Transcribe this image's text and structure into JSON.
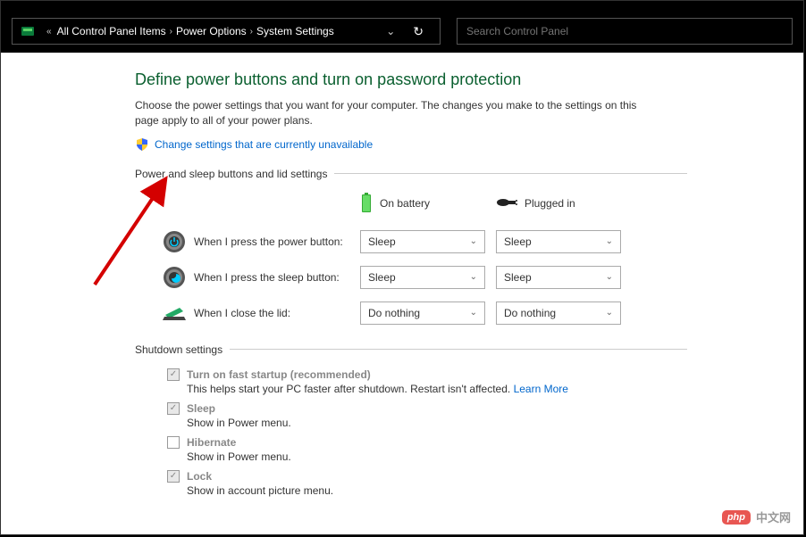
{
  "breadcrumb": {
    "prefix": "«",
    "items": [
      "All Control Panel Items",
      "Power Options",
      "System Settings"
    ]
  },
  "search": {
    "placeholder": "Search Control Panel"
  },
  "page": {
    "title": "Define power buttons and turn on password protection",
    "description": "Choose the power settings that you want for your computer. The changes you make to the settings on this page apply to all of your power plans.",
    "change_link": "Change settings that are currently unavailable"
  },
  "power_section": {
    "header": "Power and sleep buttons and lid settings",
    "col_battery": "On battery",
    "col_plugged": "Plugged in",
    "rows": [
      {
        "label": "When I press the power button:",
        "battery": "Sleep",
        "plugged": "Sleep"
      },
      {
        "label": "When I press the sleep button:",
        "battery": "Sleep",
        "plugged": "Sleep"
      },
      {
        "label": "When I close the lid:",
        "battery": "Do nothing",
        "plugged": "Do nothing"
      }
    ]
  },
  "shutdown_section": {
    "header": "Shutdown settings",
    "items": [
      {
        "label": "Turn on fast startup (recommended)",
        "desc": "This helps start your PC faster after shutdown. Restart isn't affected. ",
        "checked": true,
        "learn_more": "Learn More"
      },
      {
        "label": "Sleep",
        "desc": "Show in Power menu.",
        "checked": true
      },
      {
        "label": "Hibernate",
        "desc": "Show in Power menu.",
        "checked": false
      },
      {
        "label": "Lock",
        "desc": "Show in account picture menu.",
        "checked": true
      }
    ]
  },
  "watermark": {
    "badge": "php",
    "text": "中文网"
  }
}
